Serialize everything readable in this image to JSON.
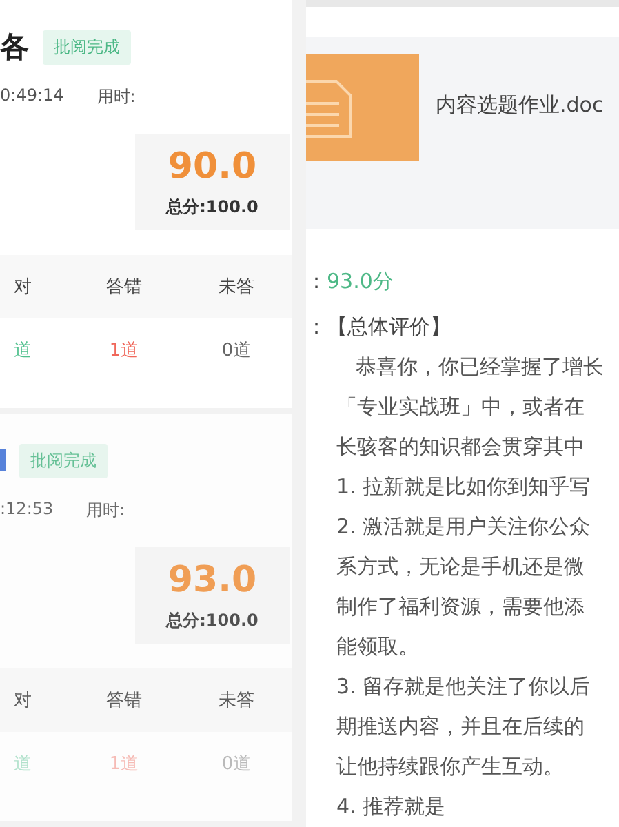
{
  "results": [
    {
      "kind": "titled",
      "title": "各",
      "tag": "批阅完成",
      "time": "0:49:14",
      "duration_label": "用时:",
      "score": "90.0",
      "total": "总分:100.0",
      "columns": [
        "对",
        "答错",
        "未答"
      ],
      "counts": [
        {
          "text": "道",
          "kind": "right"
        },
        {
          "text": "1道",
          "kind": "wrong"
        },
        {
          "text": "0道",
          "kind": "blank"
        }
      ],
      "faded": false
    },
    {
      "kind": "marked",
      "tag": "批阅完成",
      "time": ":12:53",
      "duration_label": "用时:",
      "score": "93.0",
      "total": "总分:100.0",
      "columns": [
        "对",
        "答错",
        "未答"
      ],
      "counts": [
        {
          "text": "道",
          "kind": "right"
        },
        {
          "text": "1道",
          "kind": "wrong"
        },
        {
          "text": "0道",
          "kind": "blank"
        }
      ],
      "faded": true
    }
  ],
  "detail": {
    "attachment": {
      "file_name": "内容选题作业.doc"
    },
    "score_label": "：",
    "score_value": "93.0分",
    "comment_label": "：",
    "comment_title": "【总体评价】",
    "comment_lines": [
      "恭喜你，你已经掌握了增长",
      "「专业实战班」中，或者在",
      "长骇客的知识都会贯穿其中",
      "1. 拉新就是比如你到知乎写",
      "2. 激活就是用户关注你公众",
      "系方式，无论是手机还是微",
      "制作了福利资源，需要他添",
      "能领取。",
      "3. 留存就是他关注了你以后",
      "期推送内容，并且在后续的",
      "让他持续跟你产生互动。",
      "4. 推荐就是"
    ]
  }
}
